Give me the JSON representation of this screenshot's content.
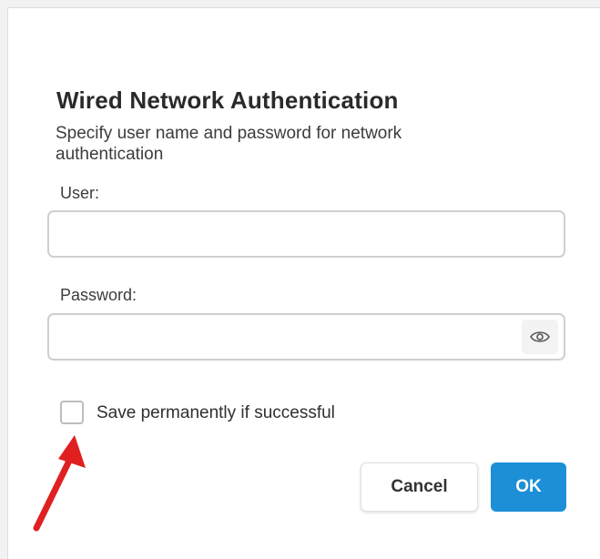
{
  "dialog": {
    "title": "Wired Network Authentication",
    "subtitle": "Specify user name and password for network authentication"
  },
  "fields": {
    "user_label": "User:",
    "user_value": "",
    "password_label": "Password:",
    "password_value": ""
  },
  "reveal_icon": "eye-icon",
  "checkbox": {
    "label": "Save permanently if successful",
    "checked": false
  },
  "buttons": {
    "cancel": "Cancel",
    "ok": "OK"
  },
  "colors": {
    "accent": "#1c8fd6",
    "annotation_arrow": "#e02020"
  }
}
